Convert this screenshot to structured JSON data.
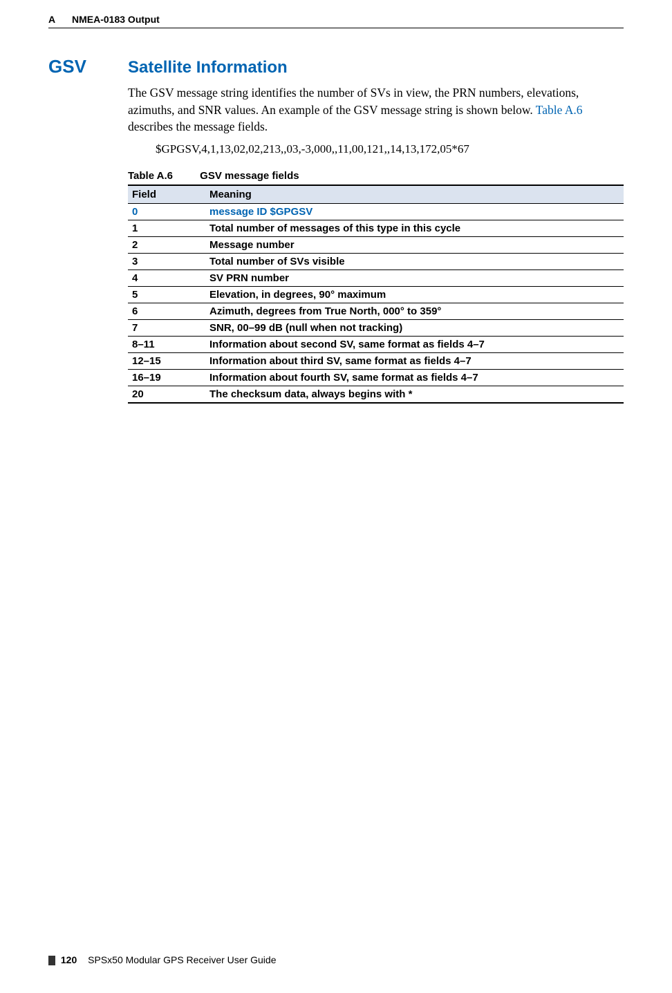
{
  "header": {
    "appendix": "A",
    "title": "NMEA-0183 Output"
  },
  "section": {
    "code": "GSV",
    "title": "Satellite Information",
    "body_pre": "The GSV message string identifies the number of SVs in view, the PRN numbers, elevations, azimuths, and SNR values. An example of the GSV message string is shown below. ",
    "table_ref": "Table A.6",
    "body_post": " describes the message fields.",
    "example": "$GPGSV,4,1,13,02,02,213,,03,-3,000,,11,00,121,,14,13,172,05*67"
  },
  "table": {
    "caption_num": "Table A.6",
    "caption_title": "GSV message fields",
    "headers": {
      "field": "Field",
      "meaning": "Meaning"
    },
    "rows": [
      {
        "field": "0",
        "meaning": "message ID $GPGSV",
        "highlight": true
      },
      {
        "field": "1",
        "meaning": "Total number of messages of this type in this cycle"
      },
      {
        "field": "2",
        "meaning": "Message number"
      },
      {
        "field": "3",
        "meaning": "Total number of SVs visible"
      },
      {
        "field": "4",
        "meaning": "SV PRN number"
      },
      {
        "field": "5",
        "meaning": "Elevation, in degrees, 90° maximum"
      },
      {
        "field": "6",
        "meaning": "Azimuth, degrees from True North, 000° to 359°"
      },
      {
        "field": "7",
        "meaning": "SNR, 00–99 dB (null when not tracking)"
      },
      {
        "field": "8–11",
        "meaning": "Information about second SV, same format as fields 4–7"
      },
      {
        "field": "12–15",
        "meaning": "Information about third SV, same format as fields 4–7"
      },
      {
        "field": "16–19",
        "meaning": "Information about fourth SV, same format as fields 4–7"
      },
      {
        "field": "20",
        "meaning": "The checksum data, always begins with *"
      }
    ]
  },
  "footer": {
    "page": "120",
    "doc": "SPSx50 Modular GPS Receiver User Guide"
  }
}
